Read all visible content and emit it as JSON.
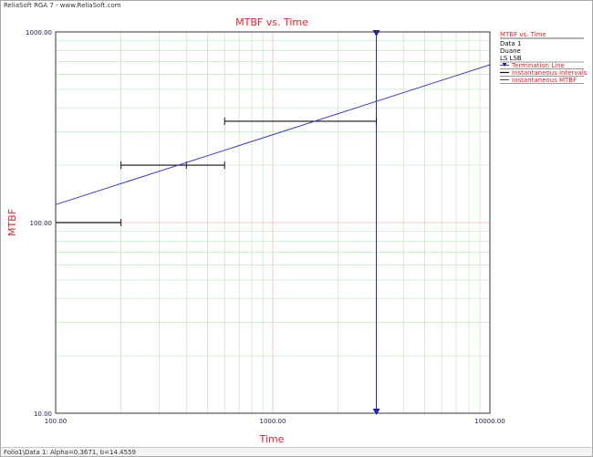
{
  "window": {
    "title": "ReliaSoft RGA 7 - www.ReliaSoft.com",
    "status": "Folio1\\Data 1: Alpha=0.3671, b=14.4559"
  },
  "colors": {
    "accent": "#e8202a",
    "fit_line": "#3a3acc",
    "termination": "#2020b0",
    "intervals": "#111111",
    "grid_major_x": "#f4b8b8",
    "grid_major_y": "#f4b8b8",
    "grid_minor": "#bde8bd"
  },
  "chart_data": {
    "type": "line",
    "title": "MTBF vs. Time",
    "xlabel": "Time",
    "ylabel": "MTBF",
    "xscale": "log",
    "yscale": "log",
    "xlim": [
      100,
      10000
    ],
    "ylim": [
      10,
      1000
    ],
    "grid": true,
    "xticks": [
      {
        "value": 100,
        "label": "100.00"
      },
      {
        "value": 1000,
        "label": "1000.00"
      },
      {
        "value": 10000,
        "label": "10000.00"
      }
    ],
    "yticks": [
      {
        "value": 10,
        "label": "10.00"
      },
      {
        "value": 100,
        "label": "100.00"
      },
      {
        "value": 1000,
        "label": "1000.00"
      }
    ],
    "legend": {
      "placement": "right",
      "title": "MTBF vs. Time",
      "info": [
        "Data 1",
        "Duane",
        "LS LSB"
      ],
      "entries": [
        {
          "name": "Termination Line",
          "marker": "triangle-down"
        },
        {
          "name": "Instantaneous Intervals",
          "marker": "interval"
        },
        {
          "name": "Instantaneous MTBF",
          "marker": "line"
        }
      ]
    },
    "series": [
      {
        "name": "Termination Line",
        "kind": "vertical-line",
        "x": 3000
      },
      {
        "name": "Instantaneous Intervals",
        "kind": "intervals",
        "segments": [
          {
            "x_start": 100,
            "x_end": 200,
            "y": 100
          },
          {
            "x_start": 200,
            "x_end": 600,
            "y": 200
          },
          {
            "x_start": 600,
            "x_end": 3000,
            "y": 340
          }
        ],
        "midpoint_ticks": [
          {
            "x": 400,
            "y": 200
          }
        ]
      },
      {
        "name": "Instantaneous MTBF",
        "kind": "fit-line",
        "x": [
          100,
          10000
        ],
        "y": [
          124.2,
          672.5
        ]
      }
    ]
  }
}
